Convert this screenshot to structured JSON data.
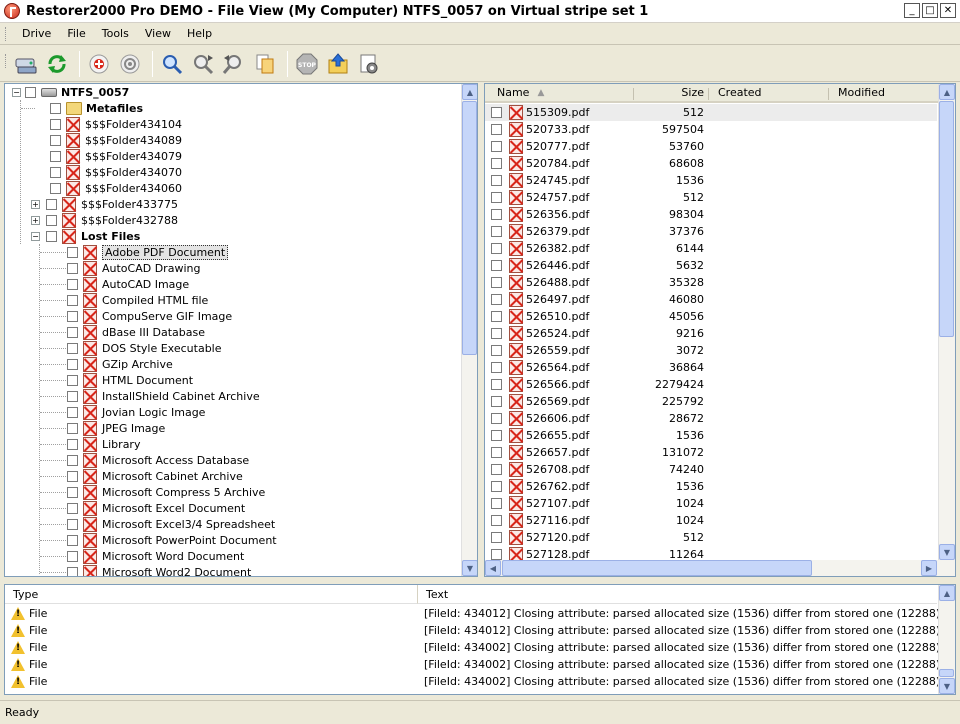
{
  "window": {
    "title": "Restorer2000 Pro DEMO - File View (My Computer) NTFS_0057 on Virtual stripe set 1",
    "minimize": "_",
    "maximize": "□",
    "close": "✕"
  },
  "menu": [
    "Drive",
    "File",
    "Tools",
    "View",
    "Help"
  ],
  "toolbar": {
    "buttons": [
      "drive-icon",
      "refresh-icon",
      "add-icon",
      "scan-icon",
      "find-icon",
      "find-next-icon",
      "find-prev-icon",
      "copy-icon",
      "stop-icon",
      "recover-icon",
      "options-icon"
    ]
  },
  "tree": {
    "root": "NTFS_0057",
    "metafiles": "Metafiles",
    "folders": [
      "$$$Folder434104",
      "$$$Folder434089",
      "$$$Folder434079",
      "$$$Folder434070",
      "$$$Folder434060",
      "$$$Folder433775",
      "$$$Folder432788"
    ],
    "lost_files": "Lost Files",
    "file_types": [
      "Adobe PDF Document",
      "AutoCAD Drawing",
      "AutoCAD Image",
      "Compiled HTML file",
      "CompuServe GIF Image",
      "dBase III Database",
      "DOS Style Executable",
      "GZip Archive",
      "HTML Document",
      "InstallShield Cabinet Archive",
      "Jovian Logic Image",
      "JPEG Image",
      "Library",
      "Microsoft Access Database",
      "Microsoft Cabinet Archive",
      "Microsoft Compress 5 Archive",
      "Microsoft Excel Document",
      "Microsoft Excel3/4 Spreadsheet",
      "Microsoft PowerPoint Document",
      "Microsoft Word Document",
      "Microsoft Word2 Document"
    ]
  },
  "files": {
    "columns": {
      "name": "Name",
      "size": "Size",
      "created": "Created",
      "modified": "Modified"
    },
    "rows": [
      [
        "515309.pdf",
        "512"
      ],
      [
        "520733.pdf",
        "597504"
      ],
      [
        "520777.pdf",
        "53760"
      ],
      [
        "520784.pdf",
        "68608"
      ],
      [
        "524745.pdf",
        "1536"
      ],
      [
        "524757.pdf",
        "512"
      ],
      [
        "526356.pdf",
        "98304"
      ],
      [
        "526379.pdf",
        "37376"
      ],
      [
        "526382.pdf",
        "6144"
      ],
      [
        "526446.pdf",
        "5632"
      ],
      [
        "526488.pdf",
        "35328"
      ],
      [
        "526497.pdf",
        "46080"
      ],
      [
        "526510.pdf",
        "45056"
      ],
      [
        "526524.pdf",
        "9216"
      ],
      [
        "526559.pdf",
        "3072"
      ],
      [
        "526564.pdf",
        "36864"
      ],
      [
        "526566.pdf",
        "2279424"
      ],
      [
        "526569.pdf",
        "225792"
      ],
      [
        "526606.pdf",
        "28672"
      ],
      [
        "526655.pdf",
        "1536"
      ],
      [
        "526657.pdf",
        "131072"
      ],
      [
        "526708.pdf",
        "74240"
      ],
      [
        "526762.pdf",
        "1536"
      ],
      [
        "527107.pdf",
        "1024"
      ],
      [
        "527116.pdf",
        "1024"
      ],
      [
        "527120.pdf",
        "512"
      ],
      [
        "527128.pdf",
        "11264"
      ]
    ]
  },
  "log": {
    "columns": {
      "type": "Type",
      "text": "Text"
    },
    "rows": [
      [
        "File",
        "[FileId: 434012] Closing attribute: parsed allocated size (1536) differ from stored one (12288)"
      ],
      [
        "File",
        "[FileId: 434012] Closing attribute: parsed allocated size (1536) differ from stored one (12288)"
      ],
      [
        "File",
        "[FileId: 434002] Closing attribute: parsed allocated size (1536) differ from stored one (12288)"
      ],
      [
        "File",
        "[FileId: 434002] Closing attribute: parsed allocated size (1536) differ from stored one (12288)"
      ],
      [
        "File",
        "[FileId: 434002] Closing attribute: parsed allocated size (1536) differ from stored one (12288)"
      ]
    ]
  },
  "status": "Ready"
}
